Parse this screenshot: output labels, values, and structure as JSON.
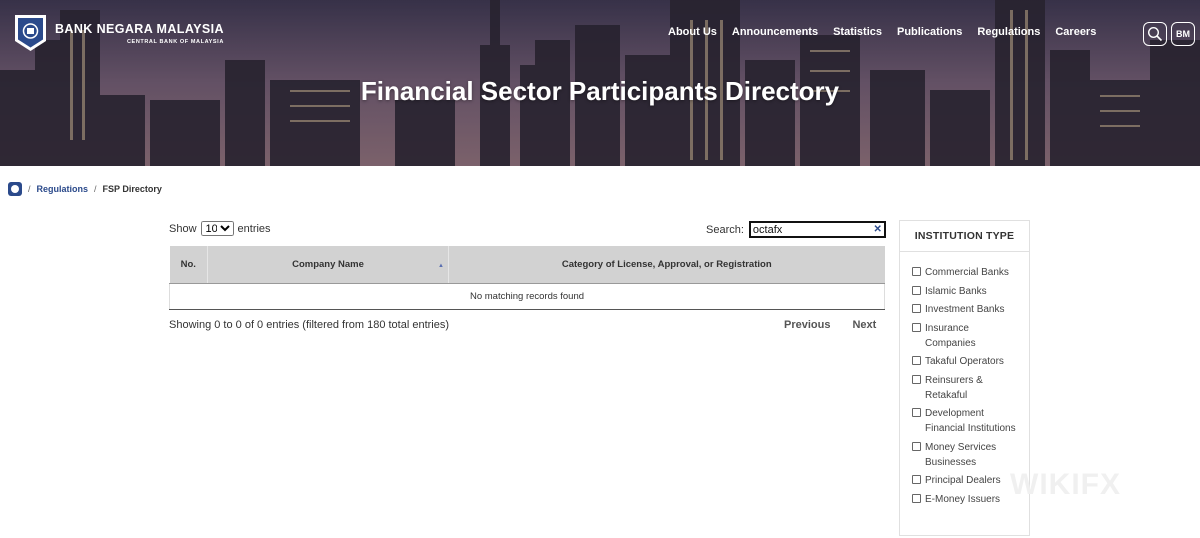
{
  "header": {
    "logo_title": "BANK NEGARA MALAYSIA",
    "logo_subtitle": "CENTRAL BANK OF MALAYSIA",
    "nav": [
      "About Us",
      "Announcements",
      "Statistics",
      "Publications",
      "Regulations",
      "Careers"
    ],
    "search_icon": "search-icon",
    "language_label": "BM",
    "page_title": "Financial Sector Participants Directory"
  },
  "breadcrumb": {
    "home_icon": "home-icon",
    "items": [
      "Regulations",
      "FSP Directory"
    ]
  },
  "table_controls": {
    "show_label": "Show",
    "entries_value": "10",
    "entries_label": "entries",
    "search_label": "Search:",
    "search_value": "octafx"
  },
  "table": {
    "columns": [
      "No.",
      "Company Name",
      "Category of License, Approval, or Registration"
    ],
    "empty_message": "No matching records found",
    "info": "Showing 0 to 0 of 0 entries (filtered from 180 total entries)",
    "previous": "Previous",
    "next": "Next"
  },
  "sidebar": {
    "title": "INSTITUTION TYPE",
    "filters": [
      "Commercial Banks",
      "Islamic Banks",
      "Investment Banks",
      "Insurance Companies",
      "Takaful Operators",
      "Reinsurers & Retakaful",
      "Development Financial Institutions",
      "Money Services Businesses",
      "Principal Dealers",
      "E-Money Issuers"
    ]
  },
  "watermark": "WIKIFX",
  "colors": {
    "brand": "#2b4a8b",
    "header_bg": "#d2d2d2"
  }
}
